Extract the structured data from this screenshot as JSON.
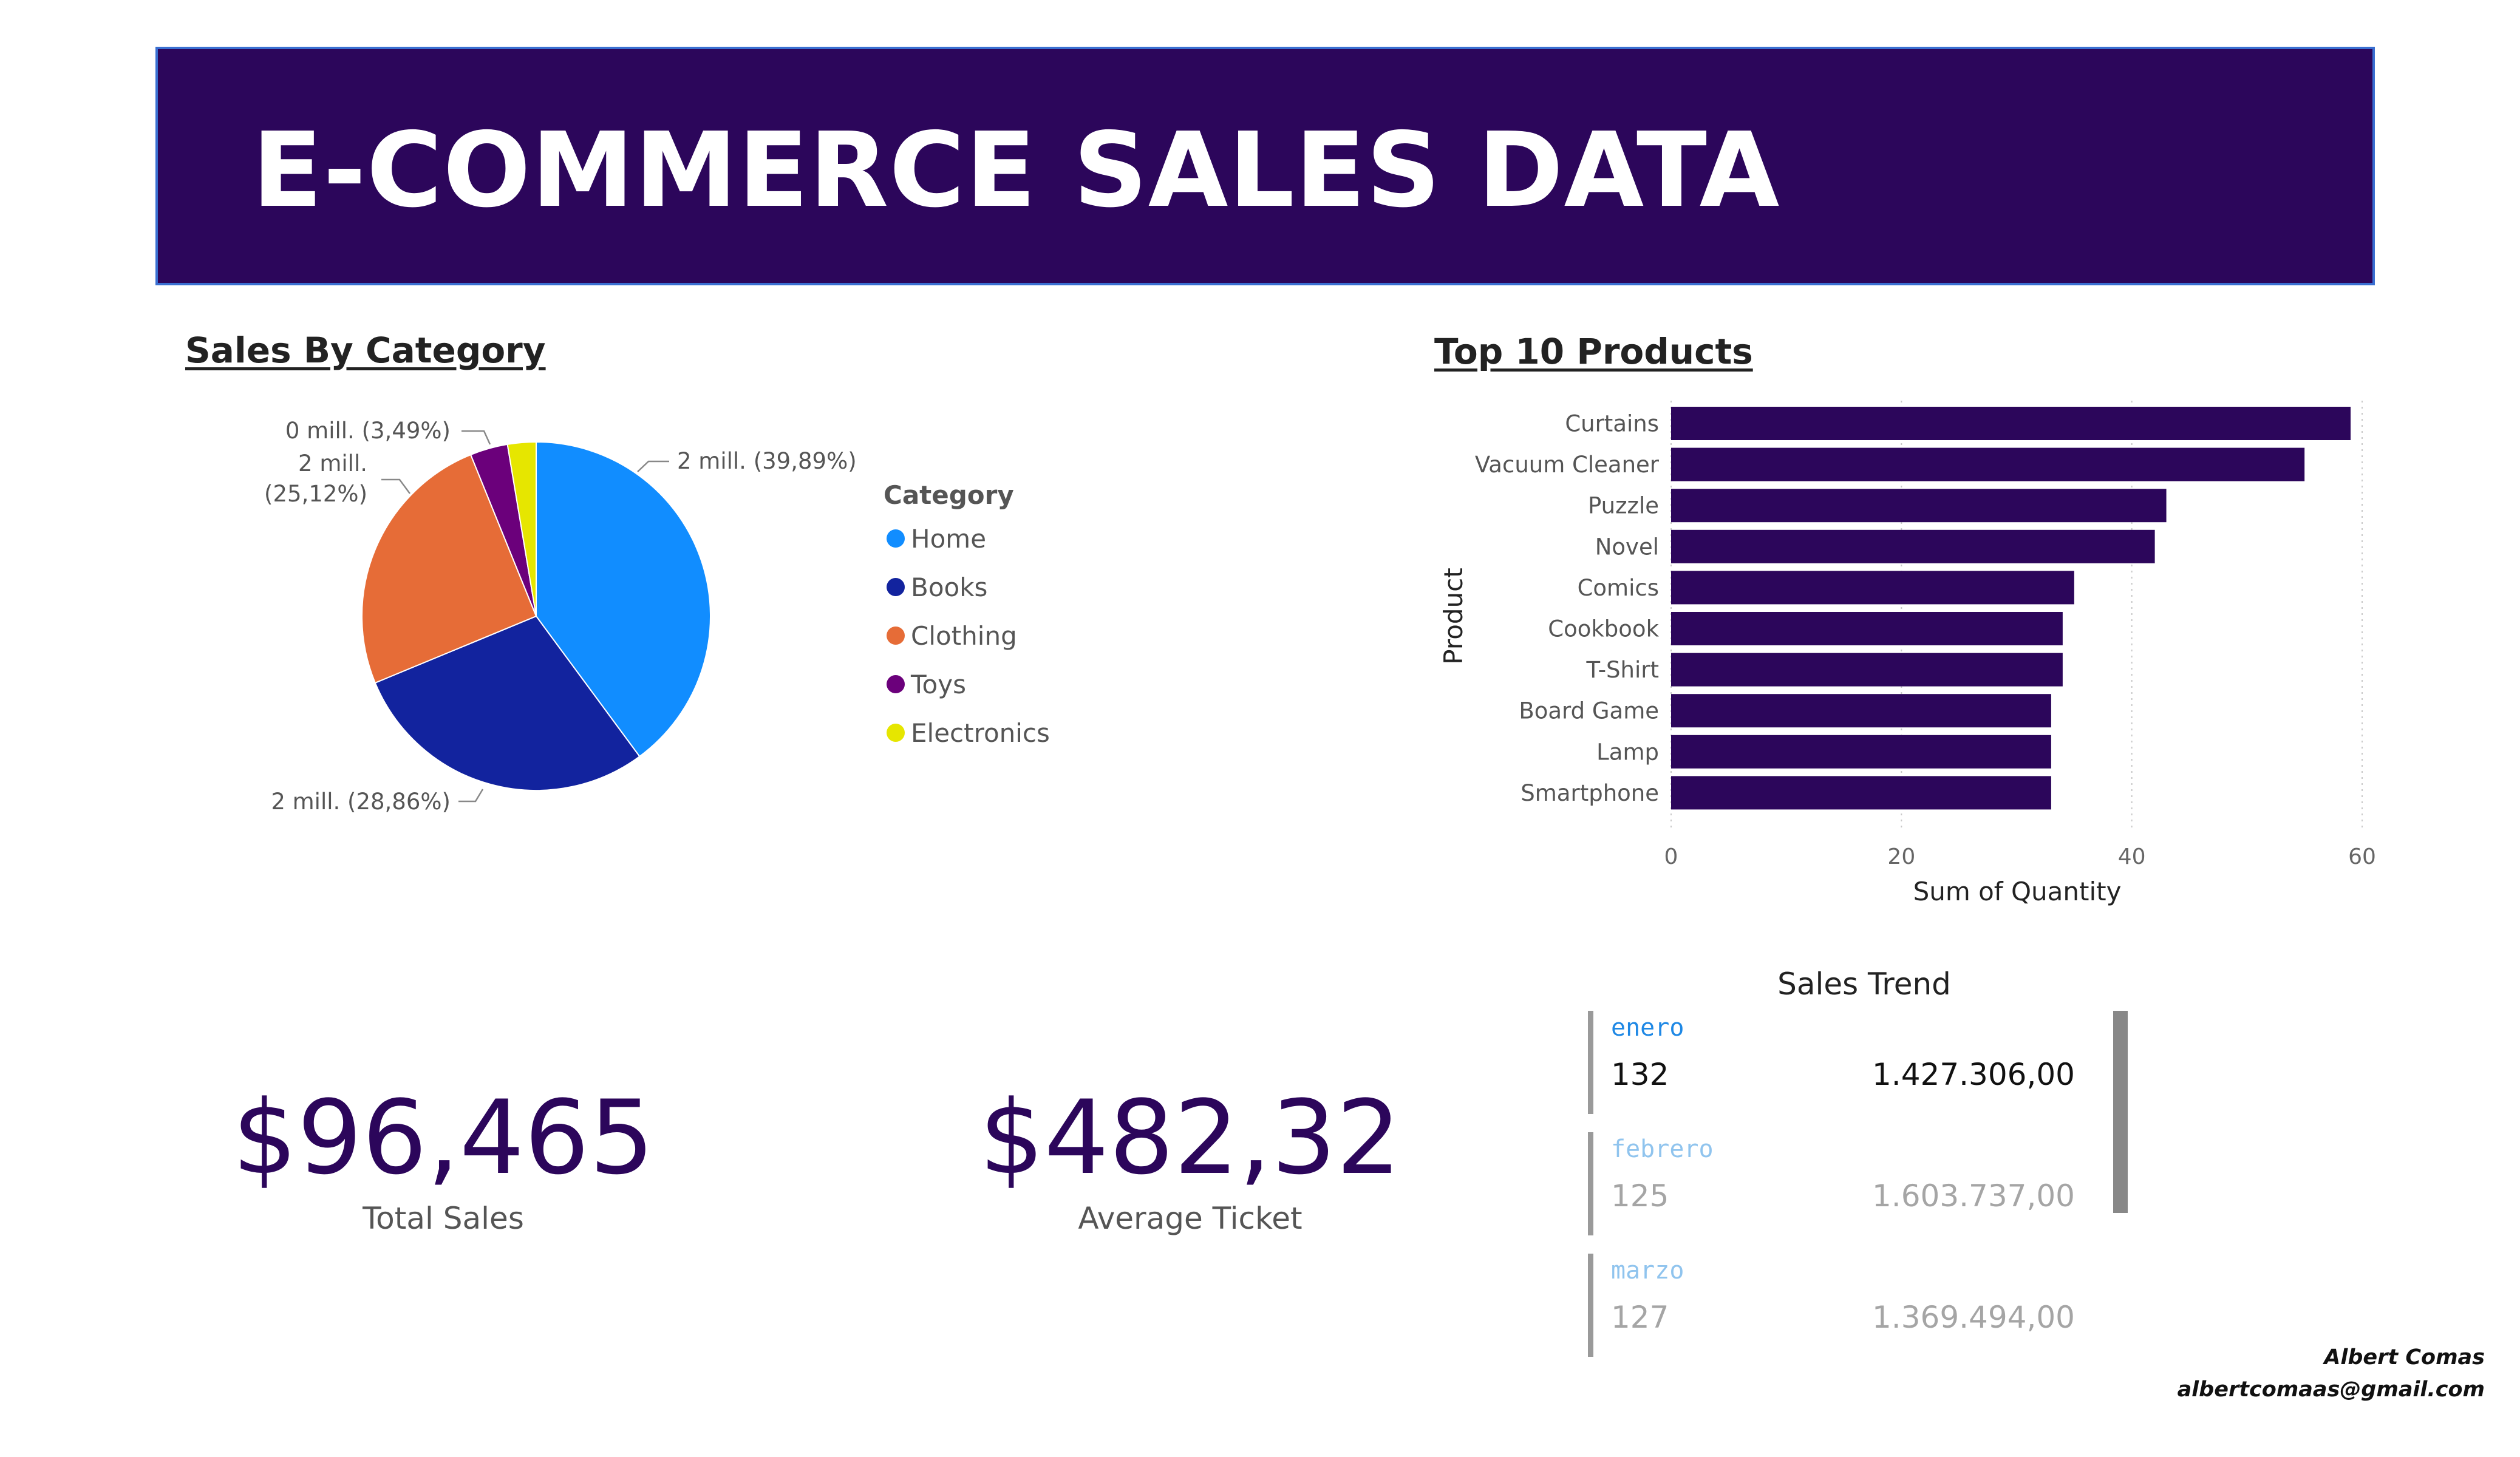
{
  "header": {
    "title": "E-COMMERCE SALES DATA"
  },
  "sales_by_category": {
    "title": "Sales By Category",
    "legend_title": "Category",
    "slice_labels": {
      "home": "2 mill. (39,89%)",
      "books": "2 mill. (28,86%)",
      "clothing_line1": "2 mill.",
      "clothing_line2": "(25,12%)",
      "toys": "0 mill. (3,49%)"
    }
  },
  "top_products": {
    "title": "Top 10 Products",
    "ylabel": "Product",
    "xlabel": "Sum of Quantity"
  },
  "kpis": {
    "total_sales_value": "$96,465",
    "total_sales_label": "Total Sales",
    "avg_ticket_value": "$482,32",
    "avg_ticket_label": "Average Ticket"
  },
  "sales_trend": {
    "title": "Sales Trend",
    "rows": [
      {
        "month": "enero",
        "count": "132",
        "amount": "1.427.306,00",
        "month_color": "#1e88e5",
        "text_color": "#111111"
      },
      {
        "month": "febrero",
        "count": "125",
        "amount": "1.603.737,00",
        "month_color": "#90c4ee",
        "text_color": "#a5a5a5"
      },
      {
        "month": "marzo",
        "count": "127",
        "amount": "1.369.494,00",
        "month_color": "#90c4ee",
        "text_color": "#a5a5a5"
      }
    ]
  },
  "signature": {
    "name": "Albert Comas",
    "email": "albertcomaas@gmail.com"
  },
  "chart_data": [
    {
      "type": "pie",
      "title": "Sales By Category",
      "legend_title": "Category",
      "legend_position": "right",
      "categories": [
        "Home",
        "Books",
        "Clothing",
        "Toys",
        "Electronics"
      ],
      "values": [
        39.89,
        28.86,
        25.12,
        3.49,
        2.64
      ],
      "colors": [
        "#118dff",
        "#12239e",
        "#e66c37",
        "#6b007b",
        "#e6e600"
      ]
    },
    {
      "type": "bar",
      "orientation": "horizontal",
      "title": "Top 10 Products",
      "categories": [
        "Curtains",
        "Vacuum Cleaner",
        "Puzzle",
        "Novel",
        "Comics",
        "Cookbook",
        "T-Shirt",
        "Board Game",
        "Lamp",
        "Smartphone"
      ],
      "values": [
        59,
        55,
        43,
        42,
        35,
        34,
        34,
        33,
        33,
        33
      ],
      "xlabel": "Sum of Quantity",
      "ylabel": "Product",
      "xlim": [
        0,
        60
      ],
      "xticks": [
        0,
        20,
        40,
        60
      ],
      "grid": true,
      "bar_color": "#2c065b"
    }
  ]
}
